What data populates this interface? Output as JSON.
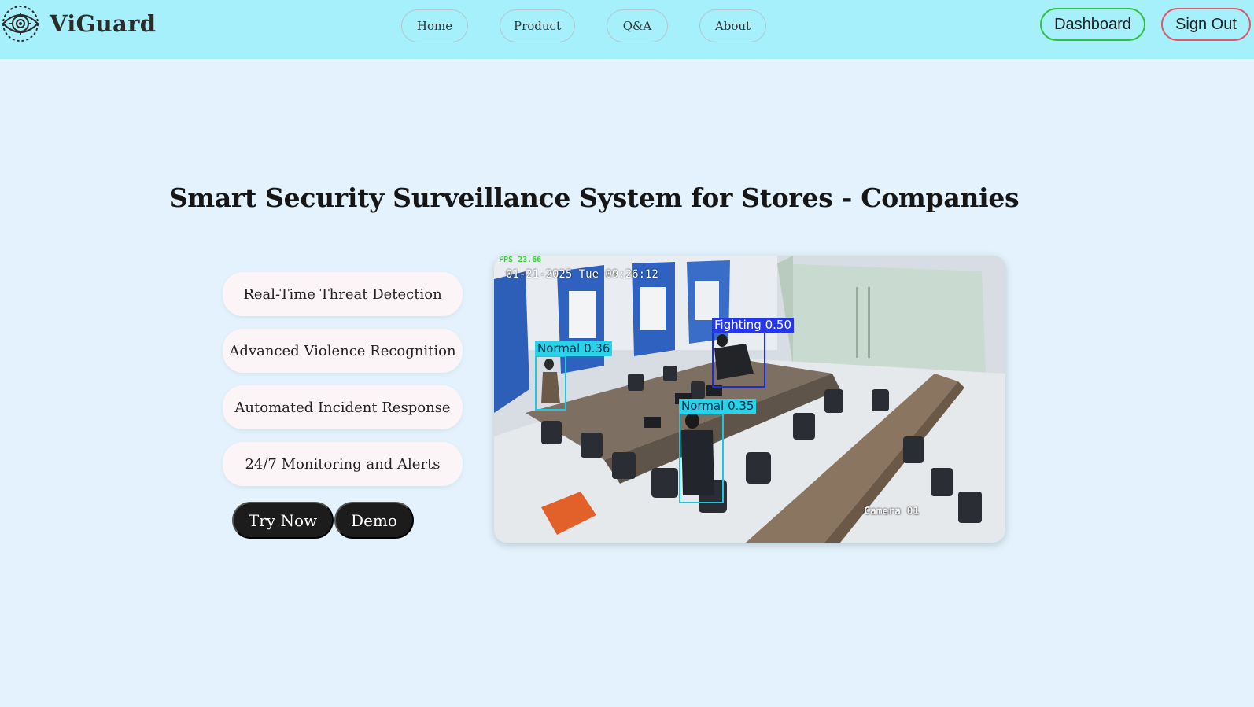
{
  "brand": {
    "name": "ViGuard",
    "logo_icon": "eye-gear-icon"
  },
  "nav": {
    "links": [
      {
        "label": "Home"
      },
      {
        "label": "Product"
      },
      {
        "label": "Q&A"
      },
      {
        "label": "About"
      }
    ],
    "dashboard_label": "Dashboard",
    "signout_label": "Sign Out"
  },
  "hero": {
    "title": "Smart Security Surveillance System for Stores - Companies",
    "features": [
      "Real-Time Threat Detection",
      "Advanced Violence Recognition",
      "Automated Incident Response",
      "24/7 Monitoring and Alerts"
    ],
    "try_label": "Try Now",
    "demo_label": "Demo"
  },
  "preview": {
    "timestamp": "01-21-2025 Tue 09:26:12",
    "fps_text": "FPS 23.66",
    "camera_label": "Camera 01",
    "detections": [
      {
        "label": "Normal",
        "score": "0.36",
        "class": "normal"
      },
      {
        "label": "Fighting",
        "score": "0.50",
        "class": "fight"
      },
      {
        "label": "Normal",
        "score": "0.35",
        "class": "normal"
      }
    ]
  },
  "colors": {
    "header_bg": "#a5f0fb",
    "page_bg": "#e3f2fc",
    "dashboard_border": "#32c040",
    "signout_border": "#e0566a",
    "cta_bg": "#1c1c1c",
    "normal_box": "#1ec7dc",
    "fight_box": "#1d2be0"
  }
}
